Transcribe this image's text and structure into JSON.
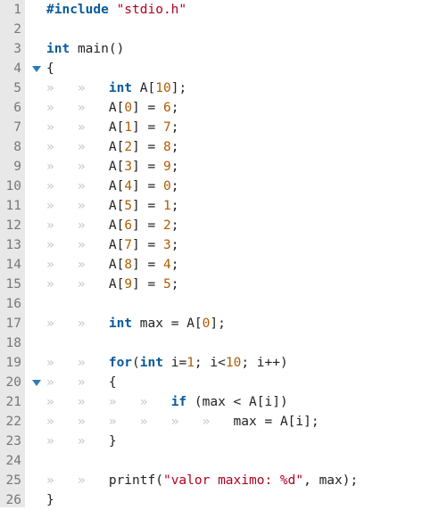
{
  "editor": {
    "font": "monospace",
    "gutter_bg": "#e8e8e8",
    "fold_marker_color": "#2b7bb9",
    "indent_guide_glyph": "»",
    "fold_marks": [
      {
        "line": 4
      },
      {
        "line": 20
      }
    ],
    "lines": [
      {
        "n": 1,
        "indent": 0,
        "tokens": [
          [
            "kw",
            "#include"
          ],
          [
            "punc",
            " "
          ],
          [
            "str",
            "\"stdio.h\""
          ]
        ]
      },
      {
        "n": 2,
        "indent": 0,
        "tokens": []
      },
      {
        "n": 3,
        "indent": 0,
        "tokens": [
          [
            "type",
            "int"
          ],
          [
            "punc",
            " "
          ],
          [
            "ident",
            "main"
          ],
          [
            "punc",
            "()"
          ]
        ]
      },
      {
        "n": 4,
        "indent": 0,
        "tokens": [
          [
            "punc",
            "{"
          ]
        ]
      },
      {
        "n": 5,
        "indent": 2,
        "tokens": [
          [
            "type",
            "int"
          ],
          [
            "punc",
            " "
          ],
          [
            "ident",
            "A"
          ],
          [
            "punc",
            "["
          ],
          [
            "num",
            "10"
          ],
          [
            "punc",
            "];"
          ]
        ]
      },
      {
        "n": 6,
        "indent": 2,
        "tokens": [
          [
            "ident",
            "A"
          ],
          [
            "punc",
            "["
          ],
          [
            "num",
            "0"
          ],
          [
            "punc",
            "] = "
          ],
          [
            "num",
            "6"
          ],
          [
            "punc",
            ";"
          ]
        ]
      },
      {
        "n": 7,
        "indent": 2,
        "tokens": [
          [
            "ident",
            "A"
          ],
          [
            "punc",
            "["
          ],
          [
            "num",
            "1"
          ],
          [
            "punc",
            "] = "
          ],
          [
            "num",
            "7"
          ],
          [
            "punc",
            ";"
          ]
        ]
      },
      {
        "n": 8,
        "indent": 2,
        "tokens": [
          [
            "ident",
            "A"
          ],
          [
            "punc",
            "["
          ],
          [
            "num",
            "2"
          ],
          [
            "punc",
            "] = "
          ],
          [
            "num",
            "8"
          ],
          [
            "punc",
            ";"
          ]
        ]
      },
      {
        "n": 9,
        "indent": 2,
        "tokens": [
          [
            "ident",
            "A"
          ],
          [
            "punc",
            "["
          ],
          [
            "num",
            "3"
          ],
          [
            "punc",
            "] = "
          ],
          [
            "num",
            "9"
          ],
          [
            "punc",
            ";"
          ]
        ]
      },
      {
        "n": 10,
        "indent": 2,
        "tokens": [
          [
            "ident",
            "A"
          ],
          [
            "punc",
            "["
          ],
          [
            "num",
            "4"
          ],
          [
            "punc",
            "] = "
          ],
          [
            "num",
            "0"
          ],
          [
            "punc",
            ";"
          ]
        ]
      },
      {
        "n": 11,
        "indent": 2,
        "tokens": [
          [
            "ident",
            "A"
          ],
          [
            "punc",
            "["
          ],
          [
            "num",
            "5"
          ],
          [
            "punc",
            "] = "
          ],
          [
            "num",
            "1"
          ],
          [
            "punc",
            ";"
          ]
        ]
      },
      {
        "n": 12,
        "indent": 2,
        "tokens": [
          [
            "ident",
            "A"
          ],
          [
            "punc",
            "["
          ],
          [
            "num",
            "6"
          ],
          [
            "punc",
            "] = "
          ],
          [
            "num",
            "2"
          ],
          [
            "punc",
            ";"
          ]
        ]
      },
      {
        "n": 13,
        "indent": 2,
        "tokens": [
          [
            "ident",
            "A"
          ],
          [
            "punc",
            "["
          ],
          [
            "num",
            "7"
          ],
          [
            "punc",
            "] = "
          ],
          [
            "num",
            "3"
          ],
          [
            "punc",
            ";"
          ]
        ]
      },
      {
        "n": 14,
        "indent": 2,
        "tokens": [
          [
            "ident",
            "A"
          ],
          [
            "punc",
            "["
          ],
          [
            "num",
            "8"
          ],
          [
            "punc",
            "] = "
          ],
          [
            "num",
            "4"
          ],
          [
            "punc",
            ";"
          ]
        ]
      },
      {
        "n": 15,
        "indent": 2,
        "tokens": [
          [
            "ident",
            "A"
          ],
          [
            "punc",
            "["
          ],
          [
            "num",
            "9"
          ],
          [
            "punc",
            "] = "
          ],
          [
            "num",
            "5"
          ],
          [
            "punc",
            ";"
          ]
        ]
      },
      {
        "n": 16,
        "indent": 0,
        "tokens": []
      },
      {
        "n": 17,
        "indent": 2,
        "tokens": [
          [
            "type",
            "int"
          ],
          [
            "punc",
            " "
          ],
          [
            "ident",
            "max"
          ],
          [
            "punc",
            " = "
          ],
          [
            "ident",
            "A"
          ],
          [
            "punc",
            "["
          ],
          [
            "num",
            "0"
          ],
          [
            "punc",
            "];"
          ]
        ]
      },
      {
        "n": 18,
        "indent": 0,
        "tokens": []
      },
      {
        "n": 19,
        "indent": 2,
        "tokens": [
          [
            "kw",
            "for"
          ],
          [
            "punc",
            "("
          ],
          [
            "type",
            "int"
          ],
          [
            "punc",
            " "
          ],
          [
            "ident",
            "i"
          ],
          [
            "punc",
            "="
          ],
          [
            "num",
            "1"
          ],
          [
            "punc",
            "; "
          ],
          [
            "ident",
            "i"
          ],
          [
            "punc",
            "<"
          ],
          [
            "num",
            "10"
          ],
          [
            "punc",
            "; "
          ],
          [
            "ident",
            "i"
          ],
          [
            "punc",
            "++)"
          ]
        ]
      },
      {
        "n": 20,
        "indent": 2,
        "tokens": [
          [
            "punc",
            "{"
          ]
        ]
      },
      {
        "n": 21,
        "indent": 4,
        "tokens": [
          [
            "kw",
            "if"
          ],
          [
            "punc",
            " ("
          ],
          [
            "ident",
            "max"
          ],
          [
            "punc",
            " < "
          ],
          [
            "ident",
            "A"
          ],
          [
            "punc",
            "["
          ],
          [
            "ident",
            "i"
          ],
          [
            "punc",
            "])"
          ]
        ]
      },
      {
        "n": 22,
        "indent": 6,
        "tokens": [
          [
            "ident",
            "max"
          ],
          [
            "punc",
            " = "
          ],
          [
            "ident",
            "A"
          ],
          [
            "punc",
            "["
          ],
          [
            "ident",
            "i"
          ],
          [
            "punc",
            "];"
          ]
        ]
      },
      {
        "n": 23,
        "indent": 2,
        "tokens": [
          [
            "punc",
            "}"
          ]
        ]
      },
      {
        "n": 24,
        "indent": 0,
        "tokens": []
      },
      {
        "n": 25,
        "indent": 2,
        "tokens": [
          [
            "ident",
            "printf"
          ],
          [
            "punc",
            "("
          ],
          [
            "str",
            "\"valor maximo: %d\""
          ],
          [
            "punc",
            ", "
          ],
          [
            "ident",
            "max"
          ],
          [
            "punc",
            ");"
          ]
        ]
      },
      {
        "n": 26,
        "indent": 0,
        "tokens": [
          [
            "punc",
            "}"
          ]
        ]
      }
    ]
  }
}
